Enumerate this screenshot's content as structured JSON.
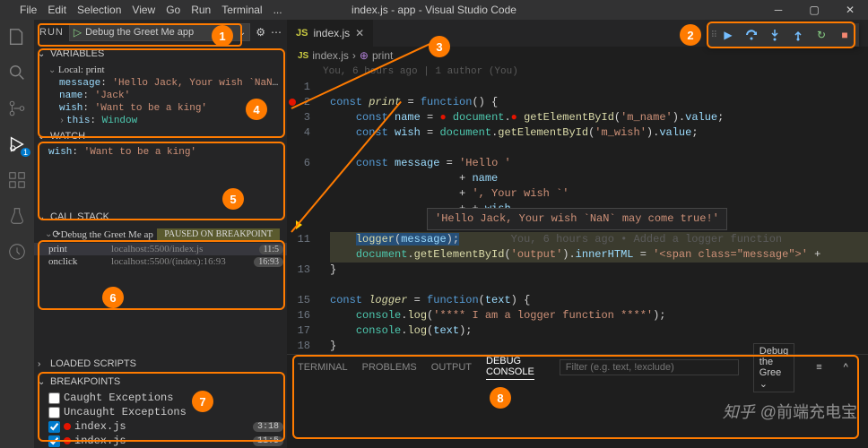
{
  "title": "index.js - app - Visual Studio Code",
  "menu": [
    "File",
    "Edit",
    "Selection",
    "View",
    "Go",
    "Run",
    "Terminal",
    "..."
  ],
  "activity_badge": 1,
  "run": {
    "label": "RUN",
    "config": "Debug the Greet Me app"
  },
  "sections": {
    "variables": "VARIABLES",
    "watch": "WATCH",
    "callstack": "CALL STACK",
    "loaded": "LOADED SCRIPTS",
    "breakpoints": "BREAKPOINTS"
  },
  "variables": {
    "scope": "Local: print",
    "items": [
      {
        "key": "message",
        "val": "'Hello Jack, Your wish `NaN` may c…",
        "type": "str"
      },
      {
        "key": "name",
        "val": "'Jack'",
        "type": "str"
      },
      {
        "key": "wish",
        "val": "'Want to be a king'",
        "type": "str"
      },
      {
        "key": "this",
        "val": "Window",
        "type": "obj",
        "expand": true
      }
    ]
  },
  "watch": [
    {
      "key": "wish",
      "val": "'Want to be a king'"
    }
  ],
  "callstack": {
    "title": "Debug the Greet Me app:",
    "status": "PAUSED ON BREAKPOINT",
    "frames": [
      {
        "func": "print",
        "loc": "localhost:5500/index.js",
        "line": "11:5",
        "sel": true
      },
      {
        "func": "onclick",
        "loc": "localhost:5500/(index):16:93",
        "line": "16:93"
      }
    ]
  },
  "breakpoints": {
    "caught": "Caught Exceptions",
    "uncaught": "Uncaught Exceptions",
    "items": [
      {
        "file": "index.js",
        "line": "3:18",
        "checked": true
      },
      {
        "file": "index.js",
        "line": "11:5",
        "checked": true
      }
    ]
  },
  "tab": {
    "name": "index.js"
  },
  "breadcrumb": {
    "file": "index.js",
    "symbol": "print"
  },
  "blame": "You, 6 hours ago | 1 author (You)",
  "inline_blame": "You, 6 hours ago • Added a logger function",
  "hover": "'Hello Jack, Your wish `NaN` may come true!'",
  "panel": {
    "tabs": [
      "TERMINAL",
      "PROBLEMS",
      "OUTPUT",
      "DEBUG CONSOLE"
    ],
    "active": 3,
    "filter_placeholder": "Filter (e.g. text, !exclude)",
    "launch": "Debug the Gree"
  },
  "watermark": {
    "brand": "知乎",
    "handle": "@前端充电宝"
  },
  "annotations": [
    1,
    2,
    3,
    4,
    5,
    6,
    7,
    8
  ]
}
